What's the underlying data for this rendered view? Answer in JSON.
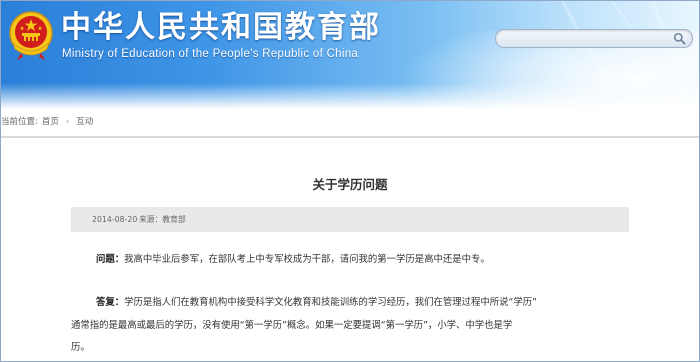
{
  "header": {
    "title": "中华人民共和国教育部",
    "subtitle": "Ministry of Education of the People's Republic of China",
    "emblem_icon": "national-emblem-icon"
  },
  "search": {
    "placeholder": "",
    "icon": "search-icon"
  },
  "breadcrumb": {
    "label": "当前位置:",
    "items": [
      "首页",
      "互动"
    ]
  },
  "article": {
    "title": "关于学历问题",
    "date": "2014-08-20",
    "source": "来源：教育部",
    "question_label": "问题：",
    "question_text": "我高中毕业后参军，在部队考上中专军校成为干部，请问我的第一学历是高中还是中专。",
    "answer_label": "答复：",
    "answer_text_line1": "学历是指人们在教育机构中接受科学文化教育和技能训练的学习经历，我们在管理过程中所说“学历”",
    "answer_text_line2": "通常指的是最高或最后的学历，没有使用“第一学历”概念。如果一定要提调“第一学历”，小学、中学也是学",
    "answer_text_line3": "历。"
  },
  "colors": {
    "banner_blue": "#2a7fd8",
    "meta_bar_gray": "#e9e9e9",
    "emblem_red": "#d21d1d",
    "emblem_gold": "#f5c518"
  }
}
